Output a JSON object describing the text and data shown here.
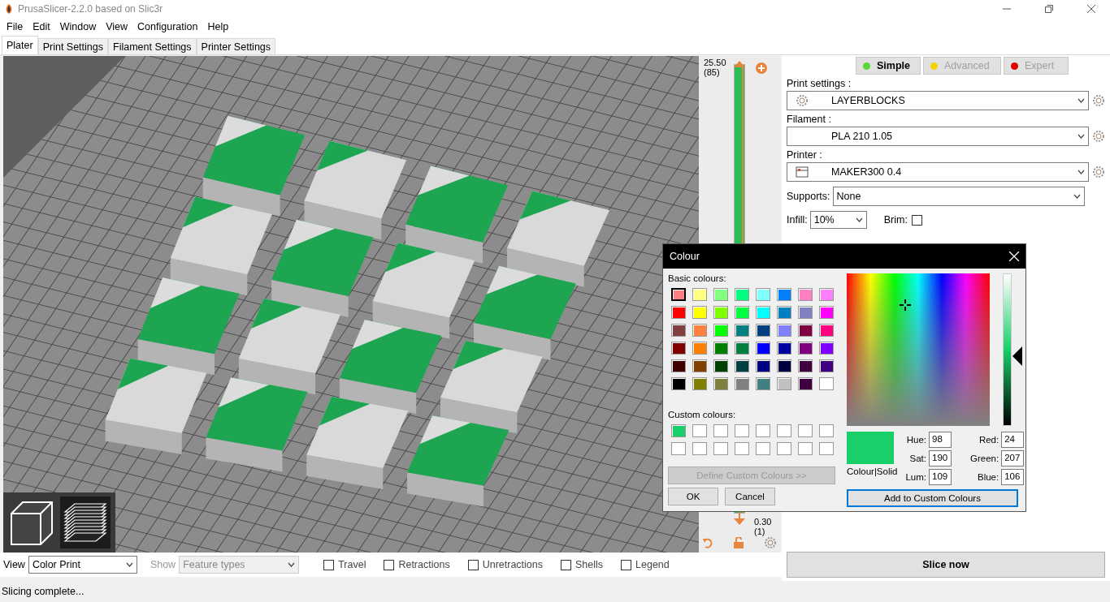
{
  "window": {
    "title": "PrusaSlicer-2.2.0 based on Slic3r"
  },
  "menu": [
    "File",
    "Edit",
    "Window",
    "View",
    "Configuration",
    "Help"
  ],
  "tabs": [
    {
      "label": "Plater",
      "selected": true
    },
    {
      "label": "Print Settings",
      "selected": false
    },
    {
      "label": "Filament Settings",
      "selected": false
    },
    {
      "label": "Printer Settings",
      "selected": false
    }
  ],
  "layer_slider": {
    "top_value": "25.50",
    "top_layer": "(85)",
    "bottom_value": "0.30",
    "bottom_layer": "(1)",
    "level": 1
  },
  "modes": [
    {
      "label": "Simple",
      "color": "#5ad838",
      "selected": true
    },
    {
      "label": "Advanced",
      "color": "#f5d300",
      "selected": false
    },
    {
      "label": "Expert",
      "color": "#e00000",
      "selected": false
    }
  ],
  "presets": [
    {
      "label": "Print settings :",
      "value": "LAYERBLOCKS",
      "kind": "print"
    },
    {
      "label": "Filament :",
      "value": "PLA 210 1.05",
      "kind": "filament"
    },
    {
      "label": "Printer :",
      "value": "MAKER300 0.4",
      "kind": "printer"
    }
  ],
  "supports": {
    "label": "Supports:",
    "value": "None"
  },
  "infill": {
    "label": "Infill:",
    "value": "10%"
  },
  "brim": {
    "label": "Brim:",
    "checked": false
  },
  "slice_button": "Slice now",
  "view": {
    "label": "View",
    "value": "Color Print"
  },
  "show": {
    "label": "Show",
    "value": "Feature types",
    "disabled": true
  },
  "options": [
    {
      "label": "Travel",
      "checked": false
    },
    {
      "label": "Retractions",
      "checked": false
    },
    {
      "label": "Unretractions",
      "checked": false
    },
    {
      "label": "Shells",
      "checked": false
    },
    {
      "label": "Legend",
      "checked": false
    }
  ],
  "status_bar": "Slicing complete...",
  "colour_dialog": {
    "title": "Colour",
    "basic_label": "Basic colours:",
    "basic": [
      {
        "color": "#ff8080",
        "selected": true
      },
      {
        "color": "#ffff80",
        "selected": false
      },
      {
        "color": "#80ff80",
        "selected": false
      },
      {
        "color": "#00ff80",
        "selected": false
      },
      {
        "color": "#80ffff",
        "selected": false
      },
      {
        "color": "#0080ff",
        "selected": false
      },
      {
        "color": "#ff80c0",
        "selected": false
      },
      {
        "color": "#ff80ff",
        "selected": false
      },
      {
        "color": "#ff0000",
        "selected": false
      },
      {
        "color": "#ffff00",
        "selected": false
      },
      {
        "color": "#80ff00",
        "selected": false
      },
      {
        "color": "#00ff40",
        "selected": false
      },
      {
        "color": "#00ffff",
        "selected": false
      },
      {
        "color": "#0080c0",
        "selected": false
      },
      {
        "color": "#8080c0",
        "selected": false
      },
      {
        "color": "#ff00ff",
        "selected": false
      },
      {
        "color": "#804040",
        "selected": false
      },
      {
        "color": "#ff8040",
        "selected": false
      },
      {
        "color": "#00ff00",
        "selected": false
      },
      {
        "color": "#008080",
        "selected": false
      },
      {
        "color": "#004080",
        "selected": false
      },
      {
        "color": "#8080ff",
        "selected": false
      },
      {
        "color": "#800040",
        "selected": false
      },
      {
        "color": "#ff0080",
        "selected": false
      },
      {
        "color": "#800000",
        "selected": false
      },
      {
        "color": "#ff8000",
        "selected": false
      },
      {
        "color": "#008000",
        "selected": false
      },
      {
        "color": "#008040",
        "selected": false
      },
      {
        "color": "#0000ff",
        "selected": false
      },
      {
        "color": "#0000a0",
        "selected": false
      },
      {
        "color": "#800080",
        "selected": false
      },
      {
        "color": "#8000ff",
        "selected": false
      },
      {
        "color": "#400000",
        "selected": false
      },
      {
        "color": "#804000",
        "selected": false
      },
      {
        "color": "#004000",
        "selected": false
      },
      {
        "color": "#004040",
        "selected": false
      },
      {
        "color": "#000080",
        "selected": false
      },
      {
        "color": "#000040",
        "selected": false
      },
      {
        "color": "#400040",
        "selected": false
      },
      {
        "color": "#400080",
        "selected": false
      },
      {
        "color": "#000000",
        "selected": false
      },
      {
        "color": "#808000",
        "selected": false
      },
      {
        "color": "#808040",
        "selected": false
      },
      {
        "color": "#808080",
        "selected": false
      },
      {
        "color": "#408080",
        "selected": false
      },
      {
        "color": "#c0c0c0",
        "selected": false
      },
      {
        "color": "#400040",
        "selected": false
      },
      {
        "color": "#ffffff",
        "selected": false
      }
    ],
    "custom_label": "Custom colours:",
    "custom": [
      {
        "color": "#18cf6a"
      },
      {
        "color": "#ffffff"
      },
      {
        "color": "#ffffff"
      },
      {
        "color": "#ffffff"
      },
      {
        "color": "#ffffff"
      },
      {
        "color": "#ffffff"
      },
      {
        "color": "#ffffff"
      },
      {
        "color": "#ffffff"
      },
      {
        "color": "#ffffff"
      },
      {
        "color": "#ffffff"
      },
      {
        "color": "#ffffff"
      },
      {
        "color": "#ffffff"
      },
      {
        "color": "#ffffff"
      },
      {
        "color": "#ffffff"
      },
      {
        "color": "#ffffff"
      },
      {
        "color": "#ffffff"
      }
    ],
    "define_button": {
      "label": "Define Custom Colours >>",
      "disabled": true
    },
    "ok": "OK",
    "cancel": "Cancel",
    "preview": {
      "color": "#18cf6a",
      "label": "Colour|Solid"
    },
    "fields": [
      {
        "label": "Hue:",
        "value": "98"
      },
      {
        "label": "Red:",
        "value": "24"
      },
      {
        "label": "Sat:",
        "value": "190"
      },
      {
        "label": "Green:",
        "value": "207"
      },
      {
        "label": "Lum:",
        "value": "109"
      },
      {
        "label": "Blue:",
        "value": "106"
      }
    ],
    "add_button": "Add to Custom Colours"
  }
}
